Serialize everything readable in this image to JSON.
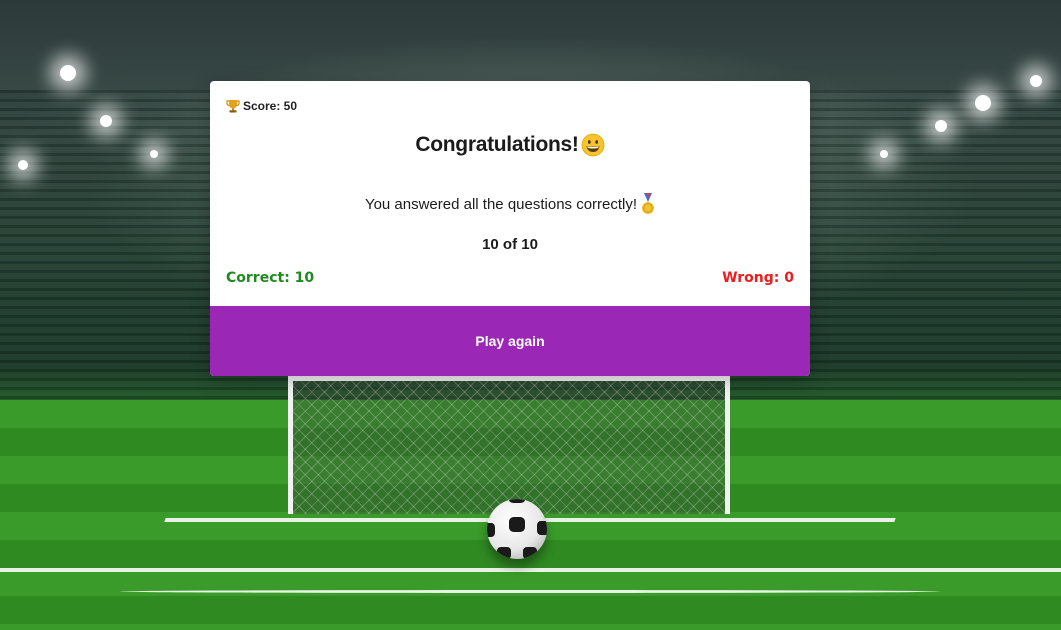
{
  "background": {
    "scene": "soccer-stadium",
    "icons": [
      "soccer-ball-icon"
    ]
  },
  "card": {
    "score_label": "Score: 50",
    "score_icon": "trophy-icon",
    "title": "Congratulations!",
    "title_icon": "grinning-face-icon",
    "message": "You answered all the questions correctly!",
    "message_icon": "medal-icon",
    "tally": "10 of 10",
    "correct_label": "Correct: 10",
    "wrong_label": "Wrong: 0",
    "play_again_label": "Play again"
  },
  "colors": {
    "accent": "#9b27b7",
    "correct": "#1f8a1f",
    "wrong": "#ee1c1c",
    "card_background": "#ffffff"
  }
}
